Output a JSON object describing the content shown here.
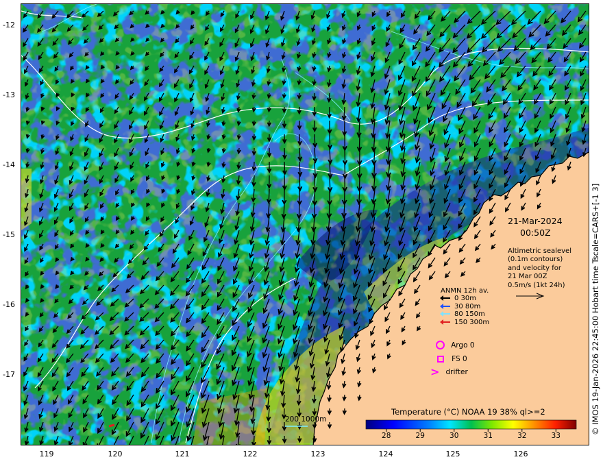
{
  "map": {
    "y_ticks": [
      "-12",
      "-13",
      "-14",
      "-15",
      "-16",
      "-17"
    ],
    "x_ticks": [
      "119",
      "120",
      "121",
      "122",
      "123",
      "124",
      "125",
      "126"
    ]
  },
  "annotation": {
    "date": "21-Mar-2024",
    "time": "00:50Z",
    "desc_lines": [
      "Altimetric sealevel",
      "(0.1m contours)",
      "and velocity for",
      "21 Mar 00Z",
      "0.5m/s (1kt 24h)"
    ]
  },
  "legend": {
    "title": "ANMN 12h av.",
    "depths": [
      {
        "label": "0 30m",
        "color": "#000000"
      },
      {
        "label": "30 80m",
        "color": "#1e50ff"
      },
      {
        "label": "80 150m",
        "color": "#7fe3ff"
      },
      {
        "label": "150 300m",
        "color": "#e02020"
      }
    ],
    "argo": "Argo 0",
    "fs": "FS 0",
    "drifter": "drifter",
    "symbol_color": "#ff00ff"
  },
  "isobath_label": "200  1000m",
  "colorbar": {
    "title": "Temperature (°C) NOAA 19 38% ql>=2",
    "ticks": [
      "28",
      "29",
      "30",
      "31",
      "32",
      "33"
    ],
    "range": [
      27.4,
      33.6
    ]
  },
  "side_credit": "© IMOS 19-Jan-2026 22:45:00 Hobart time Tscale=CARS+[-1 3]",
  "colors": {
    "land": "#fbcb9b",
    "contour": "#ffffff",
    "isobath": "#7ff0ff"
  }
}
